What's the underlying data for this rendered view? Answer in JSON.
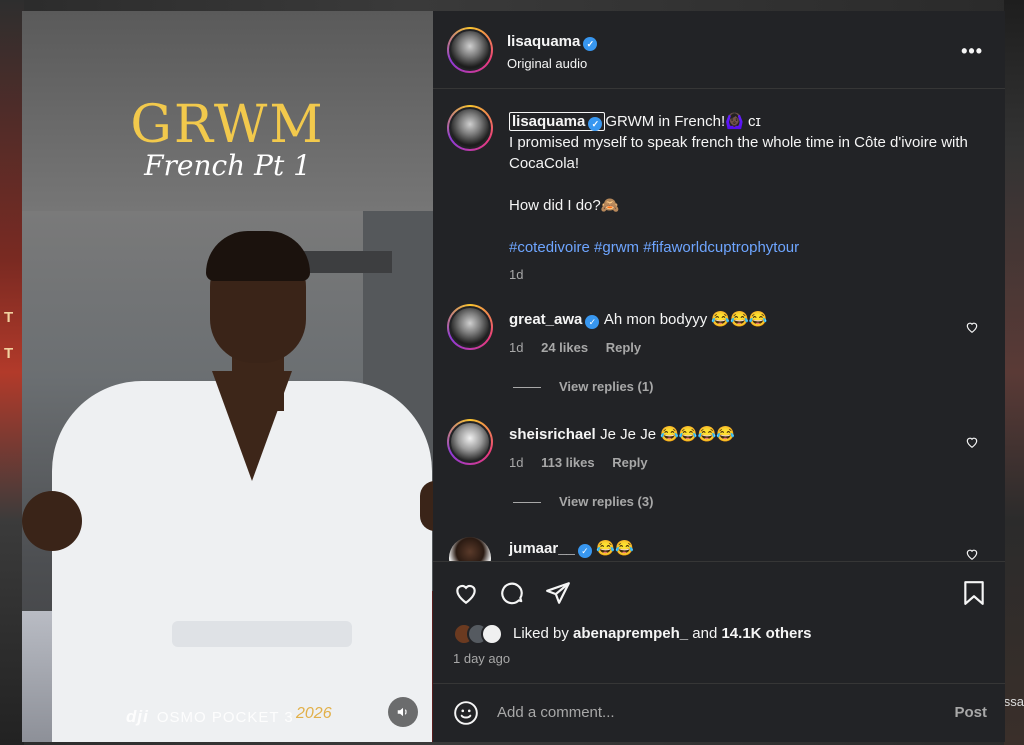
{
  "backdrop": {
    "left_text": "T\nT",
    "right_text": "ssa"
  },
  "video": {
    "title": "GRWM",
    "subtitle": "French Pt 1",
    "watermark_brand": "dji",
    "watermark_device": "OSMO POCKET 3",
    "watermark_year": "2026",
    "sound_icon": "speaker-icon"
  },
  "post": {
    "author": "lisaquama",
    "audio": "Original audio",
    "more_icon": "more-options-icon"
  },
  "caption": {
    "author": "lisaquama",
    "text_line1": "GRWM in French!🙆🏿‍♀️ cɪ",
    "text_line2": "I promised myself to speak french the whole time in Côte d'ivoire with CocaCola!",
    "text_line3": "How did I do?🙈",
    "hashtags": "#cotedivoire #grwm #fifaworldcuptrophytour",
    "time": "1d"
  },
  "comments": [
    {
      "user": "great_awa",
      "text": "Ah mon bodyyy 😂😂😂",
      "time": "1d",
      "likes": "24 likes",
      "reply": "Reply",
      "view_replies": "View replies (1)"
    },
    {
      "user": "sheisrichael",
      "text": "Je Je Je 😂😂😂😂",
      "time": "1d",
      "likes": "113 likes",
      "reply": "Reply",
      "view_replies": "View replies (3)"
    },
    {
      "user": "jumaar__",
      "text": "😂😂"
    }
  ],
  "actions": {
    "liked_prefix": "Liked by",
    "liked_user": "abenaprempeh_",
    "liked_and": "and",
    "liked_count": "14.1K others",
    "date": "1 day ago"
  },
  "comment_box": {
    "placeholder": "Add a comment...",
    "post_label": "Post"
  },
  "colors": {
    "accent_link": "#6ea5ff",
    "verified": "#3897f0",
    "panel_bg": "#222326"
  }
}
